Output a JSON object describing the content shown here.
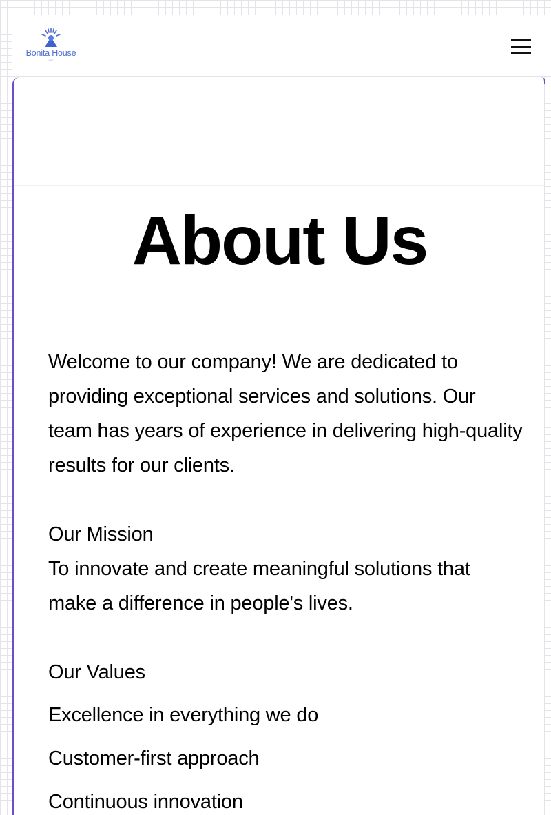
{
  "header": {
    "logo_text": "Bonita House",
    "logo_subtext": "INC",
    "menu_icon": "hamburger-menu-icon"
  },
  "about": {
    "title": "About Us",
    "intro": "Welcome to our company! We are dedicated to providing exceptional services and solutions. Our team has years of experience in delivering high-quality results for our clients.",
    "mission_heading": "Our Mission",
    "mission_text": "To innovate and create meaningful solutions that make a difference in people's lives.",
    "values_heading": "Our Values",
    "values": [
      "Excellence in everything we do",
      "Customer-first approach",
      "Continuous innovation"
    ]
  },
  "colors": {
    "logo": "#4f6fd2",
    "card_border": "#6a4fc9",
    "grid": "#e4e4e8"
  }
}
